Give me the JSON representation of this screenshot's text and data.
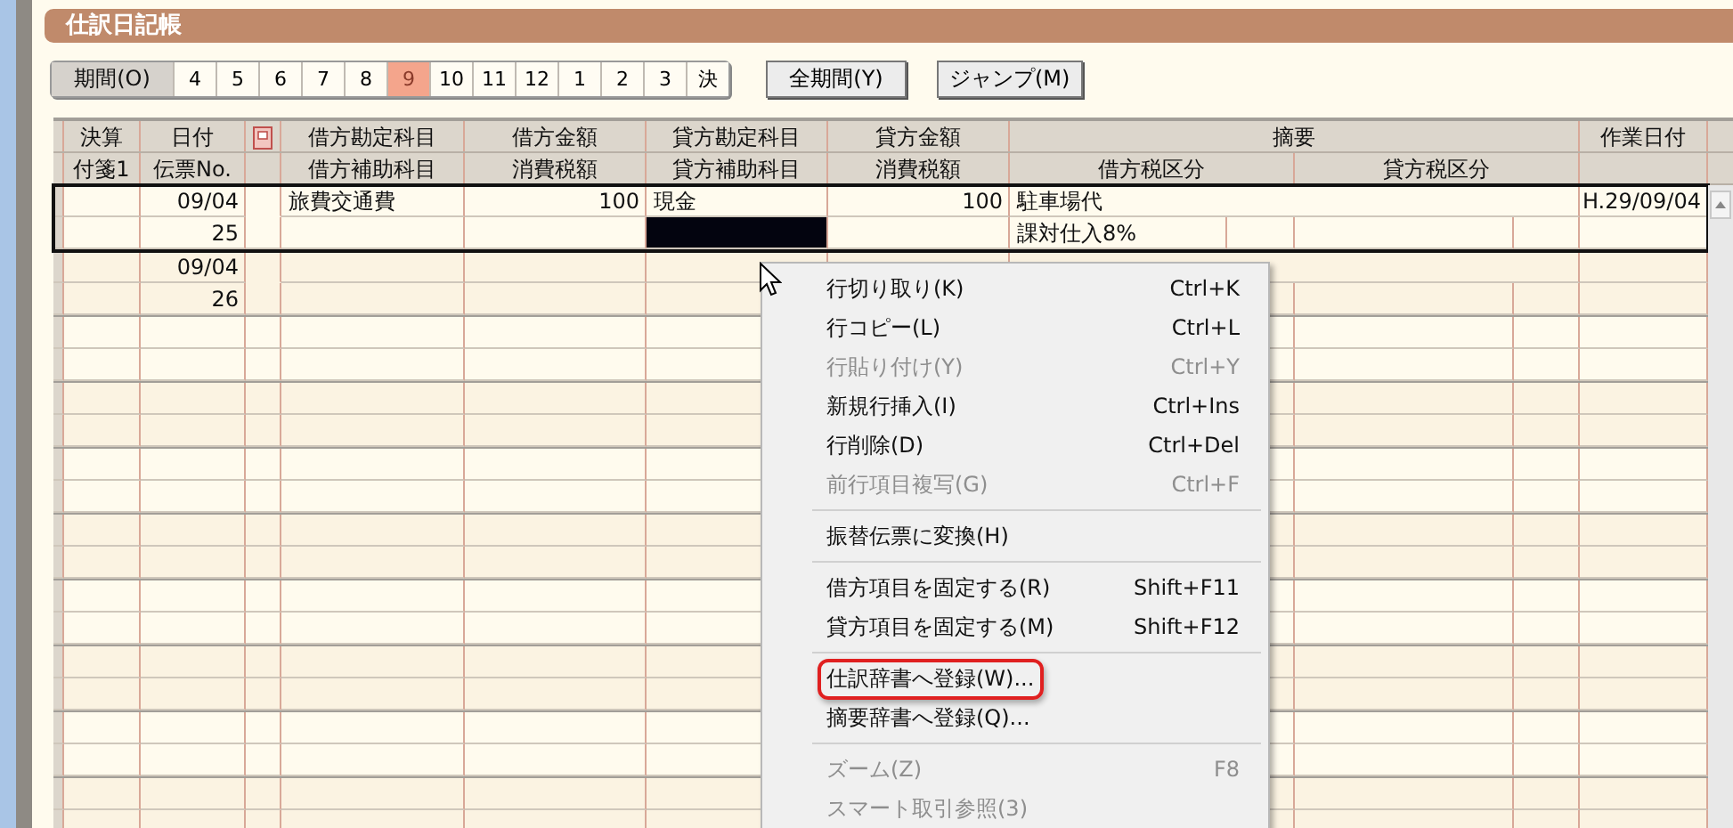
{
  "title": "仕訳日記帳",
  "period": {
    "label": "期間(O)",
    "months": [
      {
        "label": "4",
        "selected": false
      },
      {
        "label": "5",
        "selected": false
      },
      {
        "label": "6",
        "selected": false
      },
      {
        "label": "7",
        "selected": false
      },
      {
        "label": "8",
        "selected": false
      },
      {
        "label": "9",
        "selected": true
      },
      {
        "label": "10",
        "selected": false
      },
      {
        "label": "11",
        "selected": false
      },
      {
        "label": "12",
        "selected": false
      },
      {
        "label": "1",
        "selected": false
      },
      {
        "label": "2",
        "selected": false
      },
      {
        "label": "3",
        "selected": false
      },
      {
        "label": "決",
        "selected": false
      }
    ]
  },
  "buttons": [
    "全期間(Y)",
    "ジャンプ(M)"
  ],
  "table": {
    "header_top": [
      "決算",
      "日付",
      "借方勘定科目",
      "借方金額",
      "貸方勘定科目",
      "貸方金額",
      "摘要",
      "作業日付"
    ],
    "header_bottom": [
      "付箋1",
      "伝票No.",
      "借方補助科目",
      "消費税額",
      "貸方補助科目",
      "消費税額",
      "借方税区分",
      "貸方税区分"
    ],
    "rows": [
      {
        "date": "09/04",
        "number": "25",
        "debit_account": "旅費交通費",
        "debit_amount": "100",
        "credit_account": "現金",
        "credit_amount": "100",
        "summary": "駐車場代",
        "debit_tax_type": "課対仕入8%",
        "work_date": "H.29/09/04",
        "selected": true,
        "cursor_in_credit_sub": true
      },
      {
        "date": "09/04",
        "number": "26",
        "selected": false,
        "cursor_in_credit_sub": false
      }
    ]
  },
  "context_menu": [
    {
      "kind": "item",
      "label": "行切り取り(K)",
      "shortcut": "Ctrl+K",
      "disabled": false,
      "highlighted": false
    },
    {
      "kind": "item",
      "label": "行コピー(L)",
      "shortcut": "Ctrl+L",
      "disabled": false,
      "highlighted": false
    },
    {
      "kind": "item",
      "label": "行貼り付け(Y)",
      "shortcut": "Ctrl+Y",
      "disabled": true,
      "highlighted": false
    },
    {
      "kind": "item",
      "label": "新規行挿入(I)",
      "shortcut": "Ctrl+Ins",
      "disabled": false,
      "highlighted": false
    },
    {
      "kind": "item",
      "label": "行削除(D)",
      "shortcut": "Ctrl+Del",
      "disabled": false,
      "highlighted": false
    },
    {
      "kind": "item",
      "label": "前行項目複写(G)",
      "shortcut": "Ctrl+F",
      "disabled": true,
      "highlighted": false
    },
    {
      "kind": "separator"
    },
    {
      "kind": "item",
      "label": "振替伝票に変換(H)",
      "disabled": false,
      "highlighted": false
    },
    {
      "kind": "separator"
    },
    {
      "kind": "item",
      "label": "借方項目を固定する(R)",
      "shortcut": "Shift+F11",
      "disabled": false,
      "highlighted": false
    },
    {
      "kind": "item",
      "label": "貸方項目を固定する(M)",
      "shortcut": "Shift+F12",
      "disabled": false,
      "highlighted": false
    },
    {
      "kind": "separator"
    },
    {
      "kind": "item",
      "label": "仕訳辞書へ登録(W)...",
      "disabled": false,
      "highlighted": true
    },
    {
      "kind": "item",
      "label": "摘要辞書へ登録(Q)...",
      "disabled": false,
      "highlighted": false
    },
    {
      "kind": "separator"
    },
    {
      "kind": "item",
      "label": "ズーム(Z)",
      "shortcut": "F8",
      "disabled": true,
      "highlighted": false
    },
    {
      "kind": "item",
      "label": "スマート取引参照(3)",
      "disabled": true,
      "highlighted": false
    }
  ]
}
